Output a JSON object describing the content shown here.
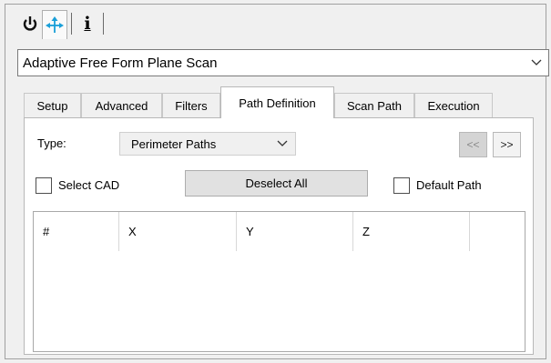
{
  "toolbar": {
    "icons": [
      "power-icon",
      "move-arrows-icon",
      "info-icon"
    ],
    "info_label": "i"
  },
  "scan_type": {
    "value": "Adaptive Free Form Plane Scan"
  },
  "tabs": [
    {
      "label": "Setup",
      "selected": false
    },
    {
      "label": "Advanced",
      "selected": false
    },
    {
      "label": "Filters",
      "selected": false
    },
    {
      "label": "Path Definition",
      "selected": true
    },
    {
      "label": "Scan Path",
      "selected": false
    },
    {
      "label": "Execution",
      "selected": false
    }
  ],
  "path_definition": {
    "type_label": "Type:",
    "type_value": "Perimeter Paths",
    "prev_label": "<<",
    "next_label": ">>",
    "select_cad_label": "Select CAD",
    "select_cad_checked": false,
    "deselect_all_label": "Deselect All",
    "default_path_label": "Default Path",
    "default_path_checked": false,
    "table": {
      "columns": [
        "#",
        "X",
        "Y",
        "Z",
        ""
      ],
      "rows": []
    }
  },
  "colors": {
    "accent_icon": "#1a9fd8",
    "window_bg": "#f0f0f0",
    "panel_bg": "#ffffff"
  }
}
